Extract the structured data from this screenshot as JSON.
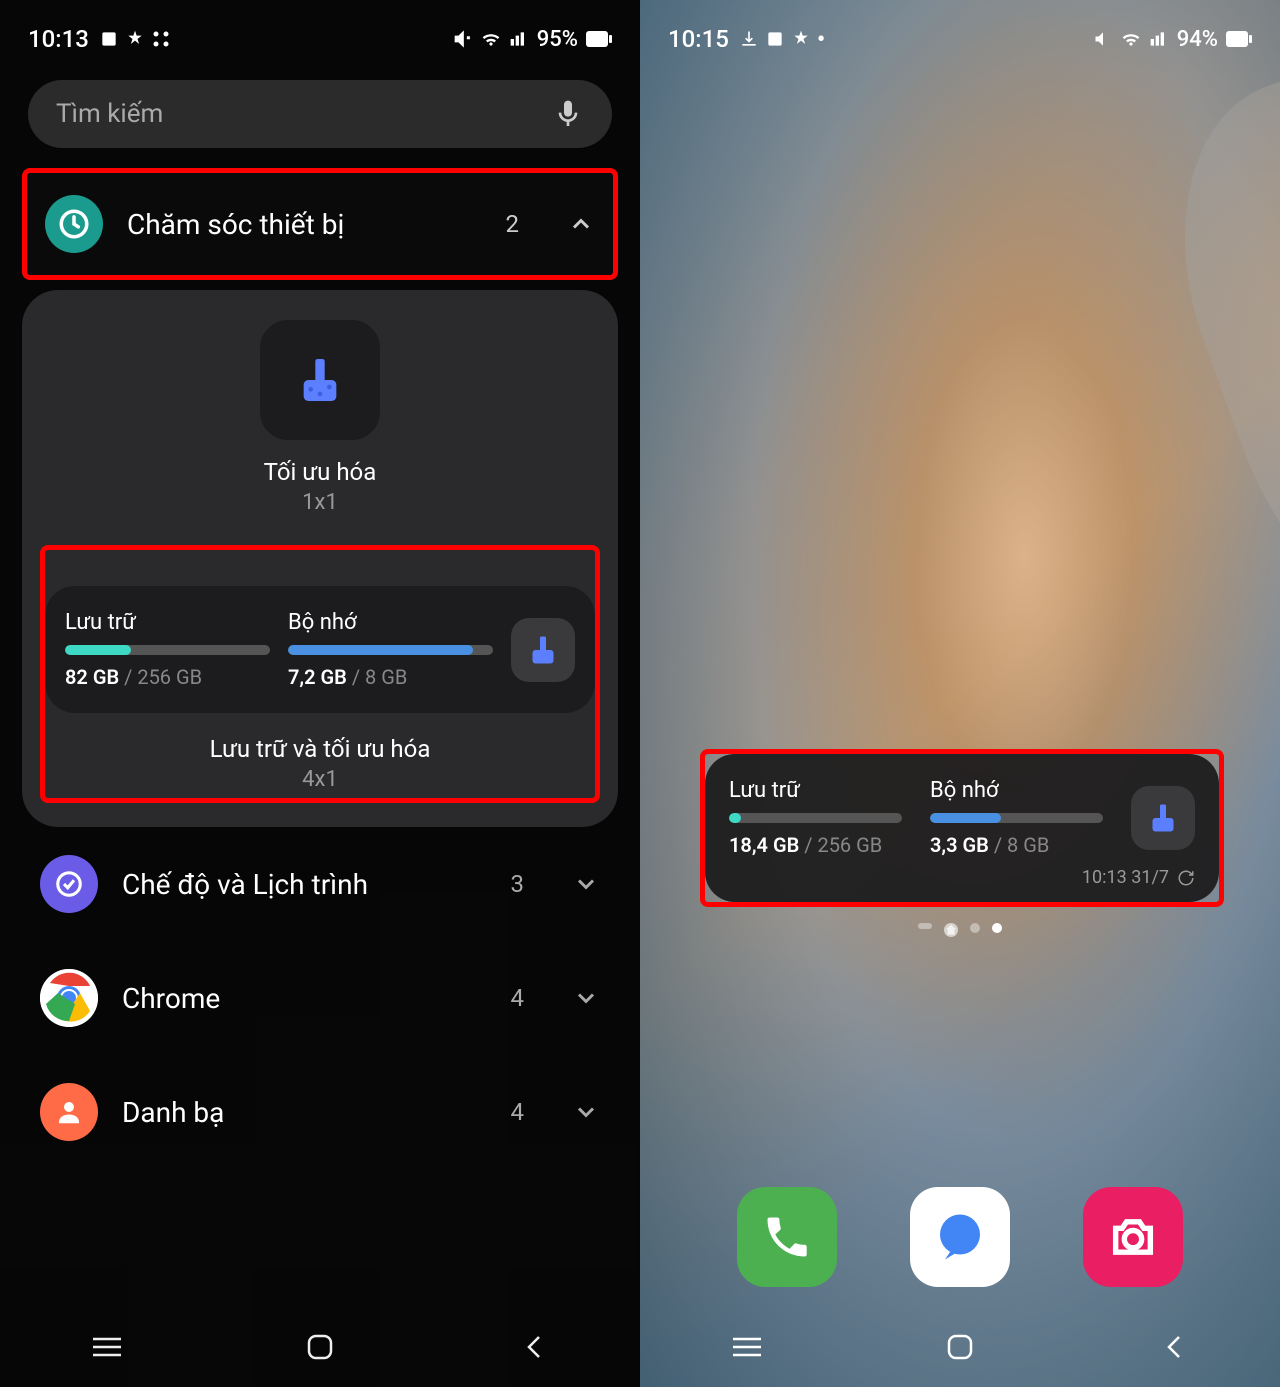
{
  "left": {
    "status": {
      "time": "10:13",
      "battery": "95%"
    },
    "search": {
      "placeholder": "Tìm kiếm"
    },
    "deviceCare": {
      "name": "Chăm sóc thiết bị",
      "count": "2"
    },
    "widget1": {
      "name": "Tối ưu hóa",
      "size": "1x1"
    },
    "widget2": {
      "storage": {
        "label": "Lưu trữ",
        "used": "82 GB",
        "total": " / 256 GB",
        "pct": 32
      },
      "memory": {
        "label": "Bộ nhớ",
        "used": "7,2 GB",
        "total": " / 8 GB",
        "pct": 90
      },
      "name": "Lưu trữ và tối ưu hóa",
      "size": "4x1"
    },
    "rows": [
      {
        "label": "Chế độ và Lịch trình",
        "count": "3"
      },
      {
        "label": "Chrome",
        "count": "4"
      },
      {
        "label": "Danh bạ",
        "count": "4"
      }
    ]
  },
  "right": {
    "status": {
      "time": "10:15",
      "battery": "94%"
    },
    "widget": {
      "storage": {
        "label": "Lưu trữ",
        "used": "18,4 GB",
        "total": " / 256 GB",
        "pct": 7
      },
      "memory": {
        "label": "Bộ nhớ",
        "used": "3,3 GB",
        "total": " / 8 GB",
        "pct": 41
      },
      "timestamp": "10:13 31/7"
    }
  }
}
